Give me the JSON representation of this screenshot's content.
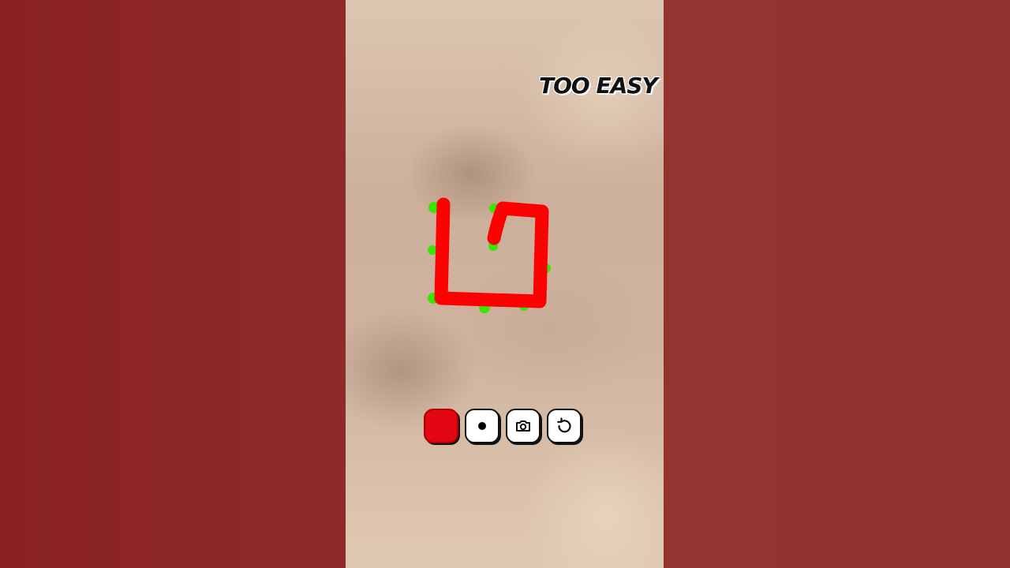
{
  "caption": {
    "text": "TOO EASY"
  },
  "colors": {
    "stroke": "#ff0000",
    "guide": "#39e600",
    "background_side": "#8e2b2a"
  },
  "toolbar": {
    "buttons": [
      {
        "name": "color-swatch-button",
        "icon": "red-swatch",
        "color": "#e30613"
      },
      {
        "name": "brush-size-button",
        "icon": "dot-icon"
      },
      {
        "name": "camera-button",
        "icon": "camera-icon"
      },
      {
        "name": "undo-button",
        "icon": "undo-icon"
      }
    ]
  }
}
